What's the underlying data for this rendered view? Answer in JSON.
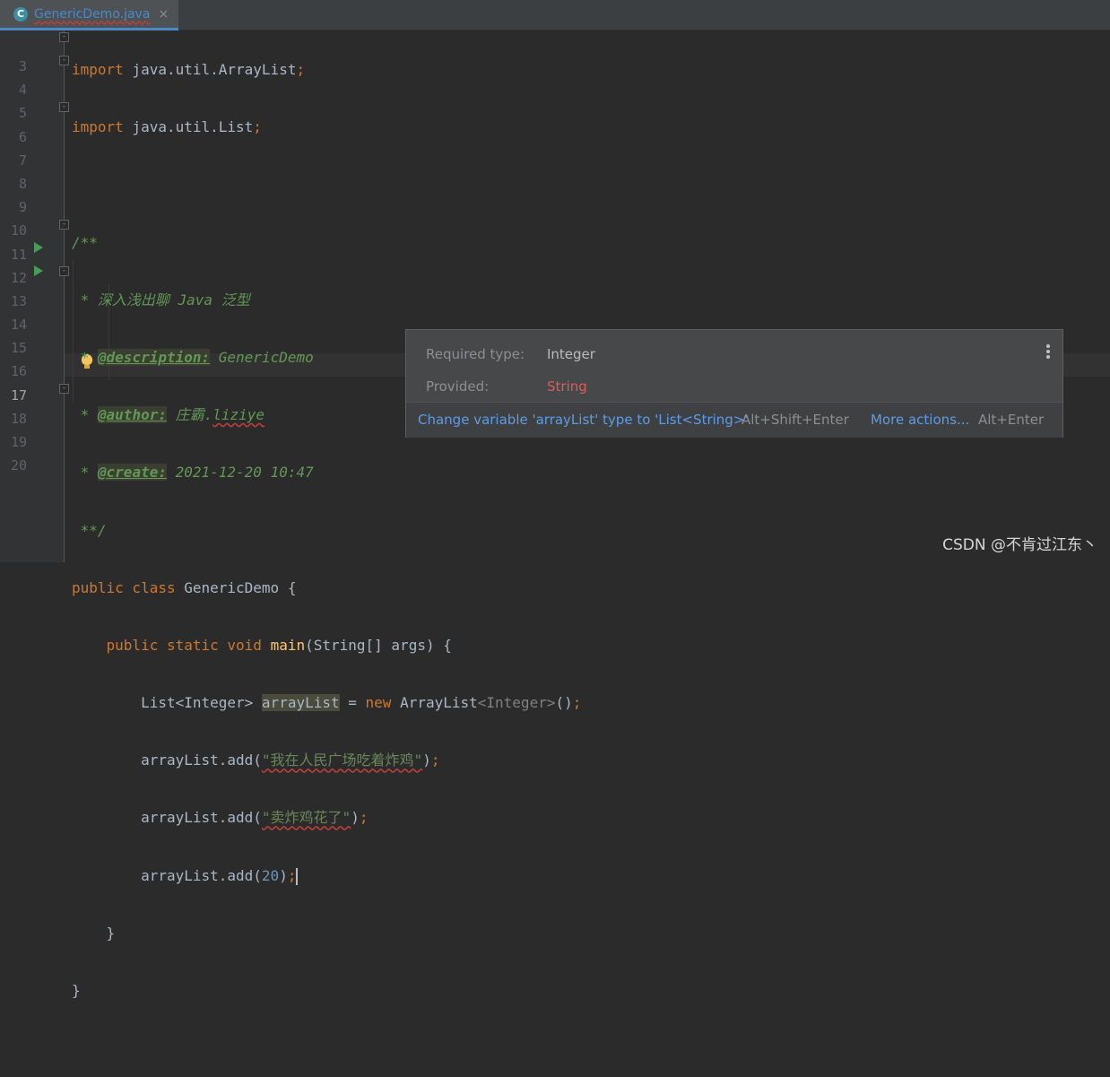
{
  "tab": {
    "file_name": "GenericDemo.java",
    "icon": "java-class-icon",
    "close": "×"
  },
  "gutter": {
    "line_numbers": [
      "3",
      "4",
      "5",
      "6",
      "7",
      "8",
      "9",
      "10",
      "11",
      "12",
      "13",
      "14",
      "15",
      "16",
      "17",
      "18",
      "19",
      "20"
    ],
    "current_line": "17"
  },
  "code": {
    "l3": {
      "kw": "import",
      "rest": " java.util.ArrayList",
      "semi": ";"
    },
    "l4": {
      "kw": "import",
      "rest": " java.util.List",
      "semi": ";"
    },
    "l6": "/**",
    "l7": " * 深入浅出聊 Java 泛型",
    "l8": {
      "prefix": " * ",
      "tag": "@description:",
      "text": " GenericDemo"
    },
    "l9": {
      "prefix": " * ",
      "tag": "@author:",
      "text": " 庄霸.",
      "name": "liziye"
    },
    "l10": {
      "prefix": " * ",
      "tag": "@create:",
      "text": " 2021-12-20 10:47"
    },
    "l11": " **/",
    "l12": {
      "kw": "public class",
      "rest": " GenericDemo {"
    },
    "l13": {
      "indent": "    ",
      "kw": "public static void",
      "sp": " ",
      "fn": "main",
      "rest": "(String[] args) {"
    },
    "l14": {
      "indent": "        ",
      "type": "List<Integer> ",
      "var": "arrayList",
      "eq": " = ",
      "kw": "new",
      "cls": " ArrayList",
      "gen": "<Integer>",
      "end": "()",
      "semi": ";"
    },
    "l15": {
      "indent": "        ",
      "call": "arrayList.add(",
      "str": "\"我在人民广场吃着炸鸡\"",
      "end": ")",
      "semi": ";"
    },
    "l16": {
      "indent": "        ",
      "call": "arrayList.add(",
      "str": "\"卖炸鸡花了\"",
      "end": ")",
      "semi": ";"
    },
    "l17": {
      "indent": "        ",
      "call": "arrayList.add(",
      "num": "20",
      "end": ")",
      "semi": ";"
    },
    "l18": "    }",
    "l19": "}"
  },
  "popup": {
    "required_label": "Required type:",
    "required_value": "Integer",
    "provided_label": "Provided:",
    "provided_value": "String",
    "fix_action": "Change variable 'arrayList' type to 'List<String>'",
    "fix_shortcut": "Alt+Shift+Enter",
    "more_actions": "More actions...",
    "more_shortcut": "Alt+Enter",
    "menu_icon": "more-vertical-icon"
  },
  "colors": {
    "keyword": "#cc7832",
    "comment": "#629755",
    "string": "#6a8759",
    "number": "#6897bb",
    "error": "#e2595a",
    "link": "#5c9ce6",
    "tab_accent": "#4a88c7"
  },
  "watermark": "CSDN @不肯过江东丶"
}
